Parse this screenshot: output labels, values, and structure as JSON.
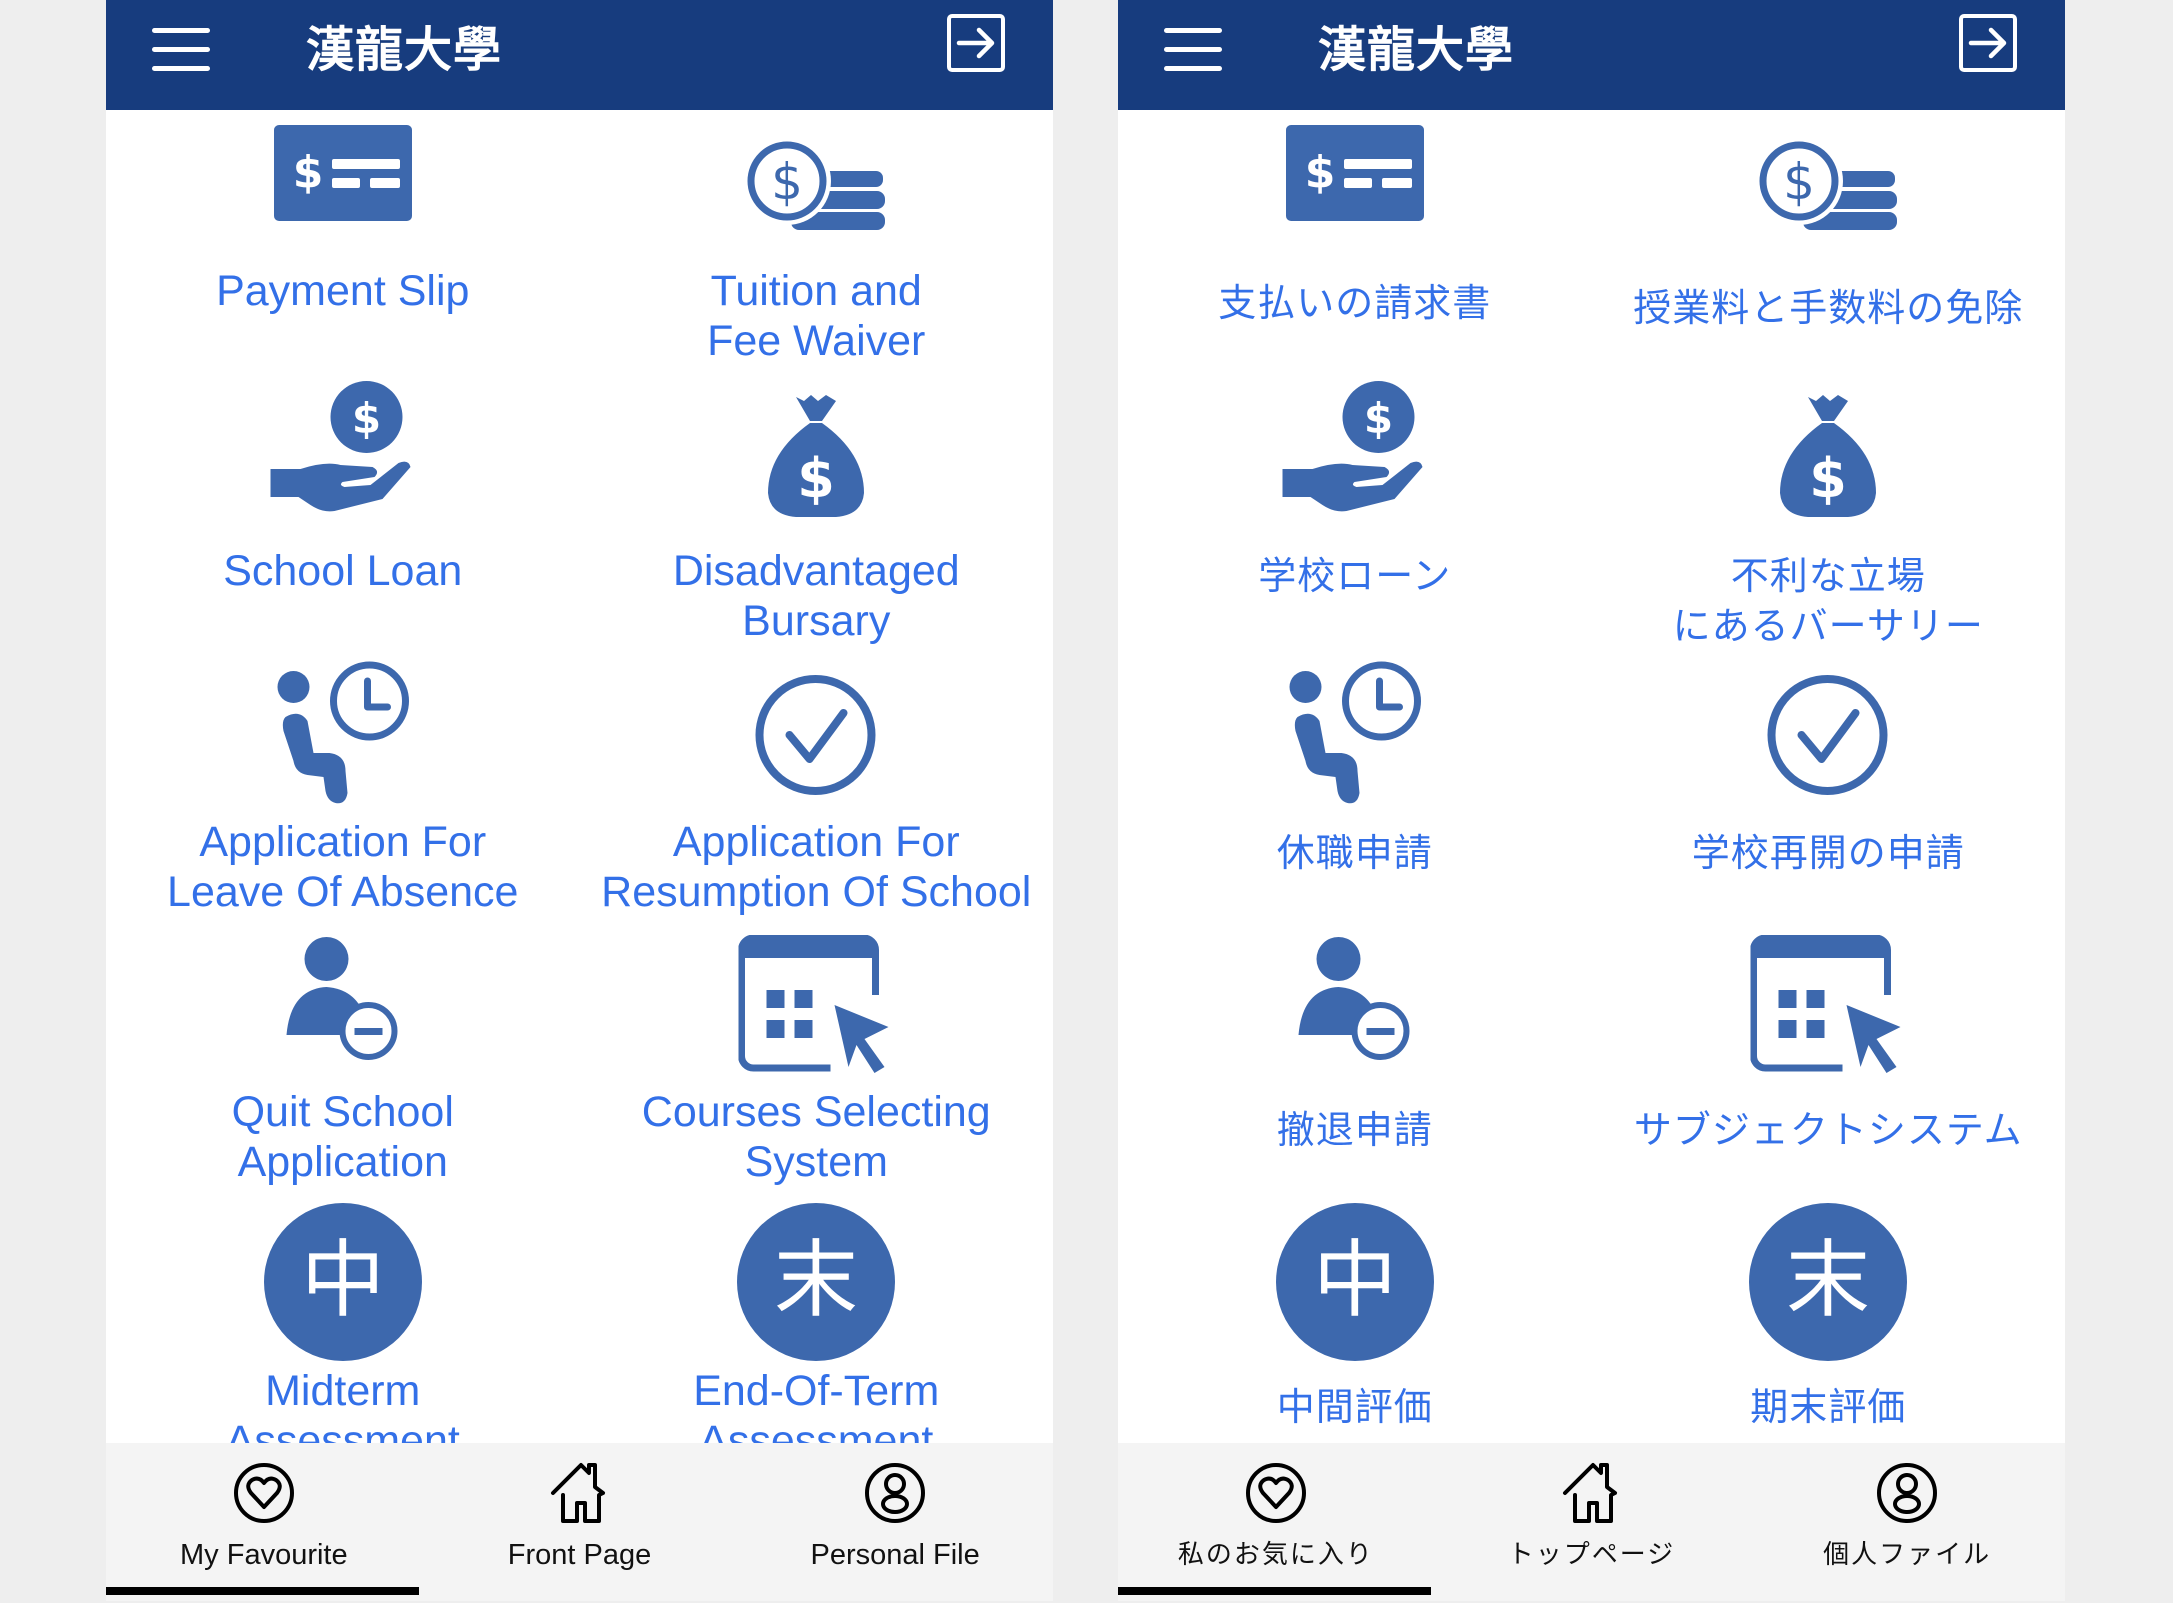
{
  "colors": {
    "header_bg": "#173c7e",
    "icon": "#3d68ad",
    "label": "#3370e8",
    "nav_bg": "#f4f4f4",
    "page_bg": "#eeeeee"
  },
  "panels": [
    {
      "language": "en",
      "header": {
        "menu_icon": "hamburger-menu-icon",
        "title": "漢龍大學",
        "logout_icon": "logout-arrow-icon"
      },
      "tiles": [
        {
          "icon": "payment-slip-icon",
          "lines": [
            "Payment Slip"
          ]
        },
        {
          "icon": "coins-stack-icon",
          "lines": [
            "Tuition and",
            "Fee Waiver"
          ]
        },
        {
          "icon": "hand-coin-icon",
          "lines": [
            "School Loan"
          ]
        },
        {
          "icon": "money-bag-icon",
          "lines": [
            "Disadvantaged",
            "Bursary"
          ]
        },
        {
          "icon": "seated-person-clock-icon",
          "lines": [
            "Application For",
            "Leave Of Absence"
          ]
        },
        {
          "icon": "check-circle-icon",
          "lines": [
            "Application For",
            "Resumption Of School"
          ]
        },
        {
          "icon": "user-minus-icon",
          "lines": [
            "Quit School",
            "Application"
          ]
        },
        {
          "icon": "calendar-cursor-icon",
          "lines": [
            "Courses Selecting",
            "System"
          ]
        },
        {
          "icon": "midterm-badge-icon",
          "glyph": "中",
          "lines": [
            "Midterm",
            "Assessment"
          ]
        },
        {
          "icon": "end-term-badge-icon",
          "glyph": "末",
          "lines": [
            "End-Of-Term",
            "Assessment"
          ]
        }
      ],
      "nav": [
        {
          "icon": "heart-circle-icon",
          "label": "My Favourite",
          "active": true
        },
        {
          "icon": "home-icon",
          "label": "Front Page",
          "active": false
        },
        {
          "icon": "person-circle-icon",
          "label": "Personal File",
          "active": false
        }
      ]
    },
    {
      "language": "ja",
      "header": {
        "menu_icon": "hamburger-menu-icon",
        "title": "漢龍大學",
        "logout_icon": "logout-arrow-icon"
      },
      "tiles": [
        {
          "icon": "payment-slip-icon",
          "lines": [
            "支払いの請求書"
          ]
        },
        {
          "icon": "coins-stack-icon",
          "lines": [
            "授業料と手数料の免除"
          ]
        },
        {
          "icon": "hand-coin-icon",
          "lines": [
            "学校ローン"
          ]
        },
        {
          "icon": "money-bag-icon",
          "lines": [
            "不利な立場",
            "にあるバーサリー"
          ]
        },
        {
          "icon": "seated-person-clock-icon",
          "lines": [
            "休職申請"
          ]
        },
        {
          "icon": "check-circle-icon",
          "lines": [
            "学校再開の申請"
          ]
        },
        {
          "icon": "user-minus-icon",
          "lines": [
            "撤退申請"
          ]
        },
        {
          "icon": "calendar-cursor-icon",
          "lines": [
            "サブジェクトシステム"
          ]
        },
        {
          "icon": "midterm-badge-icon",
          "glyph": "中",
          "lines": [
            "中間評価"
          ]
        },
        {
          "icon": "end-term-badge-icon",
          "glyph": "末",
          "lines": [
            "期末評価"
          ]
        }
      ],
      "nav": [
        {
          "icon": "heart-circle-icon",
          "label": "私のお気に入り",
          "active": true
        },
        {
          "icon": "home-icon",
          "label": "トップページ",
          "active": false
        },
        {
          "icon": "person-circle-icon",
          "label": "個人ファイル",
          "active": false
        }
      ]
    }
  ]
}
